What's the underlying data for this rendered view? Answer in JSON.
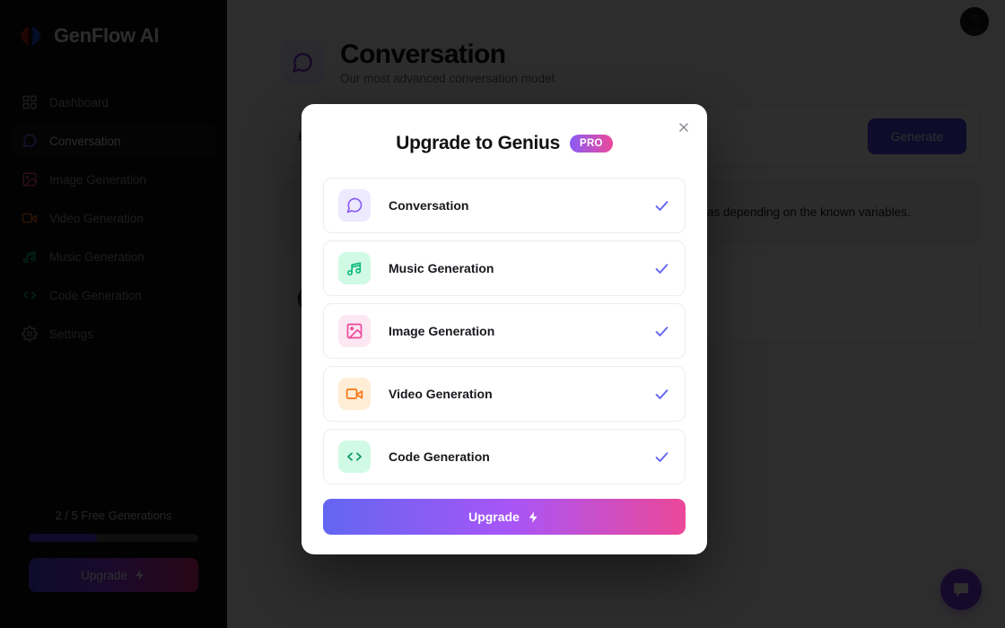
{
  "app": {
    "brand_title": "GenFlow AI",
    "brand_logo_icon": "brain-logo-icon"
  },
  "sidebar": {
    "items": [
      {
        "label": "Dashboard",
        "icon": "grid-icon",
        "active": false,
        "color": "#9a9aa4"
      },
      {
        "label": "Conversation",
        "icon": "chat-icon",
        "active": true,
        "color": "#8b5cf6"
      },
      {
        "label": "Image Generation",
        "icon": "image-icon",
        "active": false,
        "color": "#ec4899"
      },
      {
        "label": "Video Generation",
        "icon": "video-icon",
        "active": false,
        "color": "#f97316"
      },
      {
        "label": "Music Generation",
        "icon": "music-note-icon",
        "active": false,
        "color": "#10b981"
      },
      {
        "label": "Code Generation",
        "icon": "code-icon",
        "active": false,
        "color": "#22c55e"
      },
      {
        "label": "Settings",
        "icon": "gear-icon",
        "active": false,
        "color": "#9a9aa4"
      }
    ],
    "usage": {
      "label": "2 / 5 Free Generations",
      "used": 2,
      "total": 5,
      "percent": 40
    },
    "upgrade_button": {
      "label": "Upgrade",
      "icon": "lightning-bolt-icon"
    }
  },
  "topbar": {
    "avatar_icon": "user-avatar"
  },
  "page": {
    "icon": "chat-icon",
    "title": "Conversation",
    "subtitle": "Our most advanced conversation model."
  },
  "prompt": {
    "value": "How do I calculate the radius of a circle?",
    "placeholder": "How do I calculate the radius of a circle?",
    "generate_label": "Generate"
  },
  "messages": [
    {
      "role": "assistant",
      "avatar_icon": "brain-logo-icon",
      "text": "To calculate the radius of a circle, you can use one of several formulas depending on the known variables."
    },
    {
      "role": "user",
      "avatar_icon": "user-avatar",
      "text": ""
    }
  ],
  "fab": {
    "icon": "chat-bubble-icon",
    "color": "#7c3aed"
  },
  "modal": {
    "title": "Upgrade to Genius",
    "badge": "PRO",
    "close_icon": "close-icon",
    "tools": [
      {
        "label": "Conversation",
        "icon": "chat-icon",
        "bg": "#ede9fe",
        "fg": "#8b5cf6",
        "checked": true
      },
      {
        "label": "Music Generation",
        "icon": "music-note-icon",
        "bg": "#d1fae5",
        "fg": "#10b981",
        "checked": true
      },
      {
        "label": "Image Generation",
        "icon": "image-icon",
        "bg": "#fce7f3",
        "fg": "#ec4899",
        "checked": true
      },
      {
        "label": "Video Generation",
        "icon": "video-icon",
        "bg": "#ffedd5",
        "fg": "#f97316",
        "checked": true
      },
      {
        "label": "Code Generation",
        "icon": "code-icon",
        "bg": "#d1fae5",
        "fg": "#059669",
        "checked": true
      }
    ],
    "upgrade_button": {
      "label": "Upgrade",
      "icon": "lightning-bolt-icon"
    },
    "check_color": "#6366f1"
  }
}
